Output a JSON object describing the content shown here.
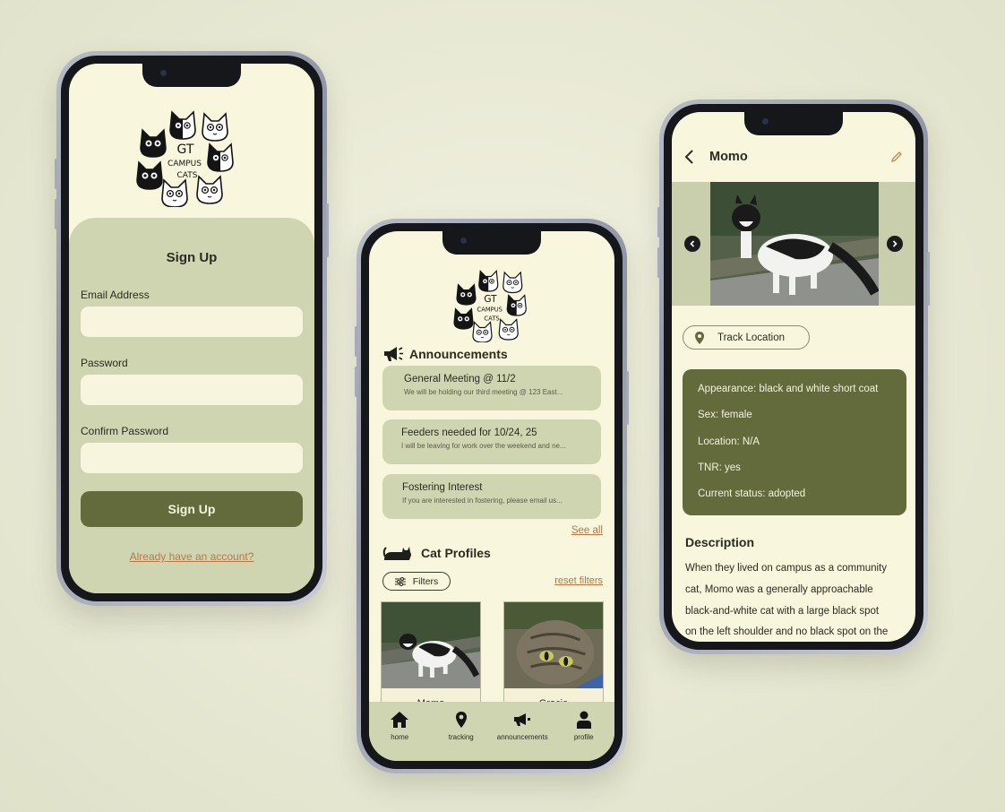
{
  "colors": {
    "background": "#e7e8d3",
    "screen": "#f8f6dc",
    "panel": "#d0d5b1",
    "accent_dark": "#636b3c",
    "link": "#b67946"
  },
  "logo": {
    "text_lines": [
      "GT",
      "CAMPUS",
      "CATS"
    ]
  },
  "signup": {
    "title": "Sign Up",
    "email_label": "Email Address",
    "email_value": "",
    "password_label": "Password",
    "password_value": "",
    "confirm_label": "Confirm Password",
    "confirm_value": "",
    "button_label": "Sign Up",
    "already_link": "Already have an account?"
  },
  "home": {
    "announcements_title": "Announcements",
    "announcements": [
      {
        "title": "General Meeting @ 11/2",
        "preview": "We will be holding our third meeting @ 123 East..."
      },
      {
        "title": "Feeders needed for 10/24, 25",
        "preview": "I will be leaving for work over the weekend and ne..."
      },
      {
        "title": "Fostering Interest",
        "preview": "If you are interested in fostering, please email us..."
      }
    ],
    "see_all": "See all",
    "profiles_title": "Cat Profiles",
    "filters_label": "Filters",
    "reset_filters": "reset filters",
    "cats": [
      {
        "name": "Momo"
      },
      {
        "name": "Gracie"
      }
    ],
    "nav": [
      {
        "label": "home",
        "icon": "home-icon"
      },
      {
        "label": "tracking",
        "icon": "location-pin-icon"
      },
      {
        "label": "announcements",
        "icon": "megaphone-icon"
      },
      {
        "label": "profile",
        "icon": "person-icon"
      }
    ]
  },
  "detail": {
    "title": "Momo",
    "track_button": "Track Location",
    "info": [
      "Appearance: black and white short coat",
      "Sex: female",
      "Location: N/A",
      "TNR: yes",
      "Current status: adopted"
    ],
    "description_title": "Description",
    "description_lines": [
      "When they lived on campus as a community",
      "cat, Momo was a generally approachable",
      "black-and-white cat with a large black spot",
      "on the left shoulder and no black spot on the"
    ]
  }
}
